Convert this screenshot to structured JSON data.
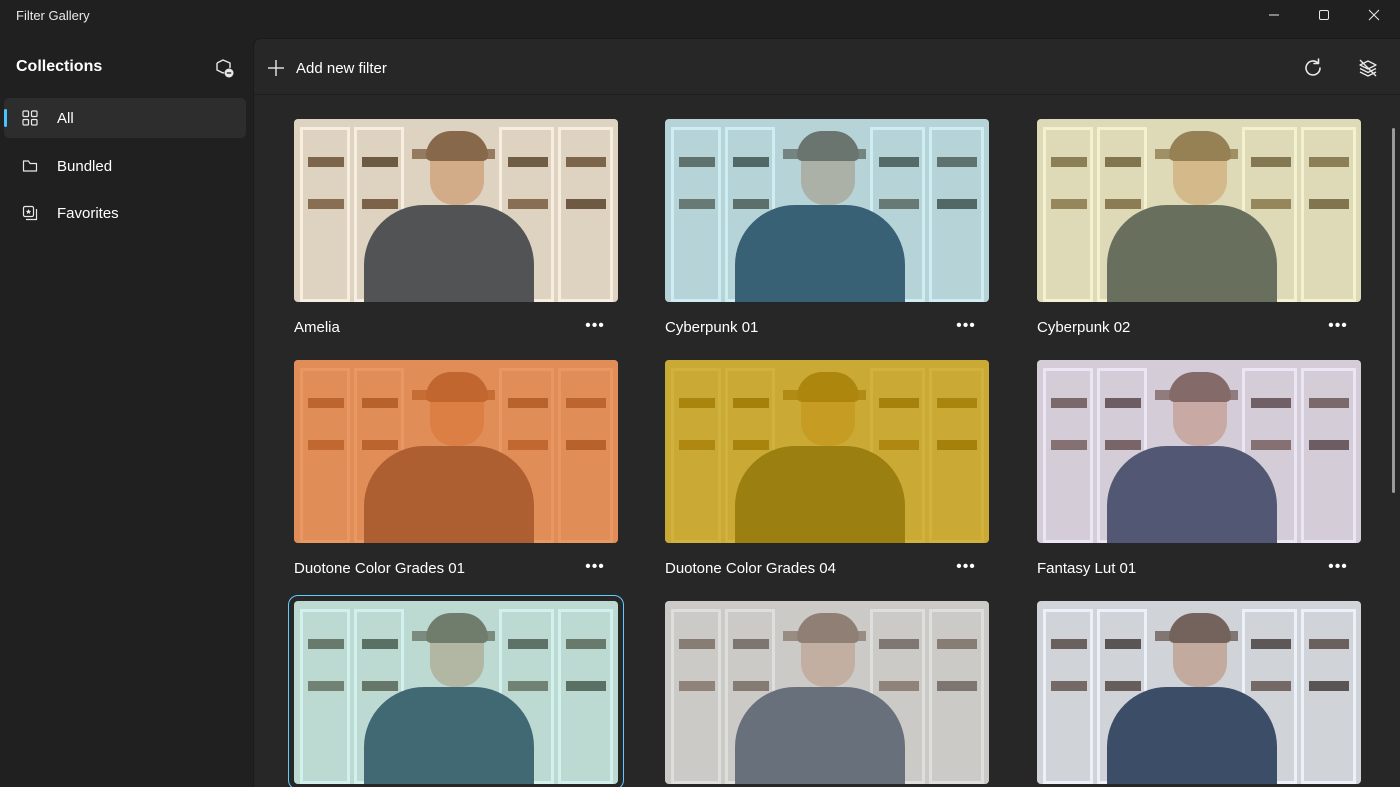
{
  "window": {
    "title": "Filter Gallery"
  },
  "sidebar": {
    "heading": "Collections",
    "add_icon": "add-collection-icon",
    "items": [
      {
        "label": "All",
        "icon": "grid-icon",
        "selected": true
      },
      {
        "label": "Bundled",
        "icon": "bundle-icon",
        "selected": false
      },
      {
        "label": "Favorites",
        "icon": "favorites-icon",
        "selected": false
      }
    ]
  },
  "toolbar": {
    "add_label": "Add new filter",
    "refresh_icon": "refresh-icon",
    "hide_icon": "layers-hide-icon"
  },
  "filters": [
    {
      "name": "Amelia",
      "tint": "#f3c98a",
      "tint_opacity": 0.22,
      "selected": false
    },
    {
      "name": "Cyberpunk 01",
      "tint": "#66d0e8",
      "tint_opacity": 0.3,
      "selected": false
    },
    {
      "name": "Cyberpunk 02",
      "tint": "#e8e38a",
      "tint_opacity": 0.35,
      "selected": false
    },
    {
      "name": "Duotone Color Grades 01",
      "tint": "#e2702a",
      "tint_opacity": 0.72,
      "selected": false
    },
    {
      "name": "Duotone Color Grades 04",
      "tint": "#c49a00",
      "tint_opacity": 0.75,
      "selected": false
    },
    {
      "name": "Fantasy Lut 01",
      "tint": "#c9b8e8",
      "tint_opacity": 0.28,
      "selected": false
    },
    {
      "name": "",
      "tint": "#7fe0d6",
      "tint_opacity": 0.32,
      "selected": true
    },
    {
      "name": "",
      "tint": "#bcbcbc",
      "tint_opacity": 0.45,
      "selected": false
    },
    {
      "name": "",
      "tint": "#a8c8ff",
      "tint_opacity": 0.18,
      "selected": false
    }
  ],
  "colors": {
    "accent": "#4cc2ff",
    "background": "#202020",
    "panel": "#272727"
  }
}
